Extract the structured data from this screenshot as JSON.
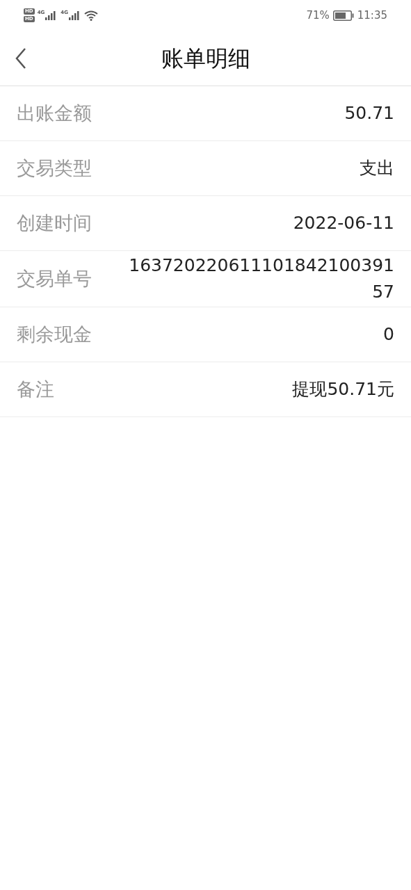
{
  "status_bar": {
    "hd_badges": [
      "HD",
      "HD"
    ],
    "networks": [
      "4G",
      "4G"
    ],
    "battery_percent": "71%",
    "time": "11:35"
  },
  "header": {
    "title": "账单明细"
  },
  "rows": [
    {
      "label": "出账金额",
      "value": "50.71"
    },
    {
      "label": "交易类型",
      "value": "支出"
    },
    {
      "label": "创建时间",
      "value": "2022-06-11"
    },
    {
      "label": "交易单号",
      "value": "16372022061110184210039157"
    },
    {
      "label": "剩余现金",
      "value": "0"
    },
    {
      "label": "备注",
      "value": "提现50.71元"
    }
  ]
}
